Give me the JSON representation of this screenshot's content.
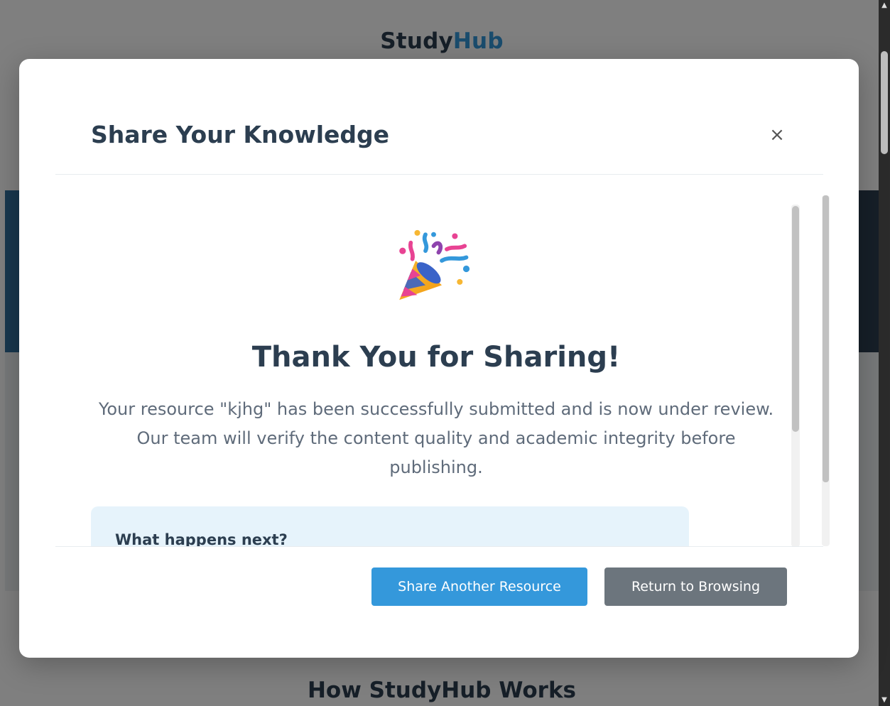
{
  "page": {
    "brand_prefix": "Study",
    "brand_highlight": "Hub",
    "section_title": "How StudyHub Works"
  },
  "modal": {
    "title": "Share Your Knowledge",
    "close_symbol": "×",
    "heading": "Thank You for Sharing!",
    "message": "Your resource \"kjhg\" has been successfully submitted and is now under review. Our team will verify the content quality and academic integrity before publishing.",
    "next_title": "What happens next?",
    "primary_button": "Share Another Resource",
    "secondary_button": "Return to Browsing"
  },
  "scrollbar": {
    "up_arrow": "▲",
    "down_arrow": "▼"
  },
  "colors": {
    "primary": "#3498db",
    "secondary": "#6c757d",
    "heading": "#2c3e50",
    "info_box": "#e6f3fb"
  },
  "icons": {
    "celebrate": "party-popper-icon",
    "close": "close-icon"
  }
}
